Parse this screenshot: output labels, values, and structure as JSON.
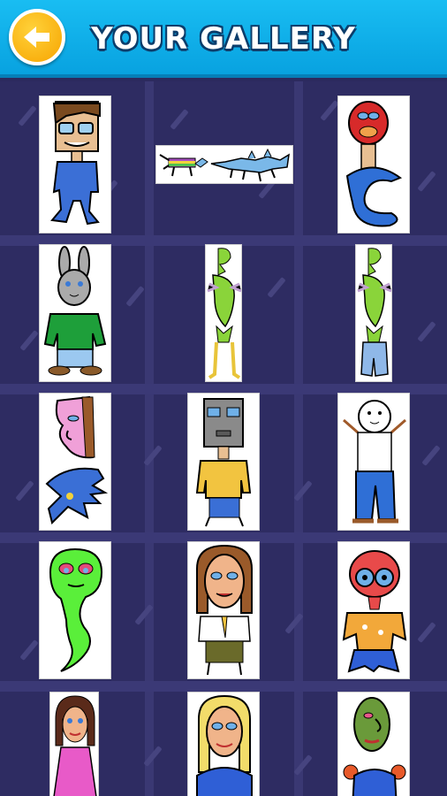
{
  "header": {
    "title": "YOUR GALLERY",
    "back_icon": "arrow-left-icon",
    "background": "#12b3ee",
    "back_color": "#f7a400"
  },
  "gallery": {
    "items": [
      {
        "name": "man-with-glasses"
      },
      {
        "name": "unicorn-and-dragon"
      },
      {
        "name": "red-face-worm"
      },
      {
        "name": "bunny-man"
      },
      {
        "name": "green-alien-yellow-legs"
      },
      {
        "name": "green-alien-blue-legs"
      },
      {
        "name": "pink-face-blue-hand"
      },
      {
        "name": "box-head-man"
      },
      {
        "name": "snowman-blue-pants"
      },
      {
        "name": "green-ghost-snake"
      },
      {
        "name": "woman-schoolgirl"
      },
      {
        "name": "bigeyed-creature"
      },
      {
        "name": "girl-pink-dress"
      },
      {
        "name": "blonde-woman"
      },
      {
        "name": "green-face-man"
      }
    ]
  }
}
